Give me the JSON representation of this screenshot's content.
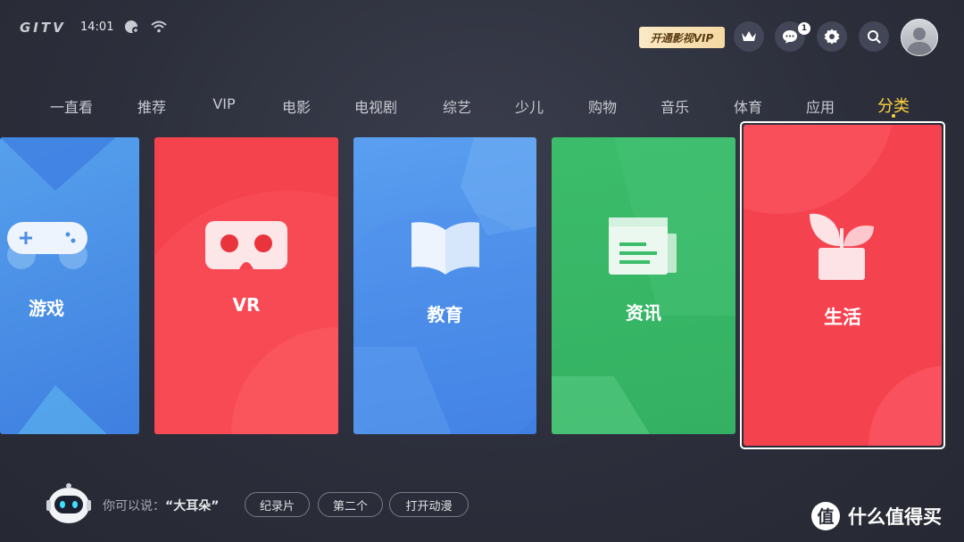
{
  "status_bar": {
    "logo": "GITV",
    "time": "14:01"
  },
  "header": {
    "vip_label": "开通影视VIP",
    "message_count": "1"
  },
  "nav": {
    "tabs": [
      {
        "label": "一直看"
      },
      {
        "label": "推荐"
      },
      {
        "label": "VIP"
      },
      {
        "label": "电影"
      },
      {
        "label": "电视剧"
      },
      {
        "label": "综艺"
      },
      {
        "label": "少儿"
      },
      {
        "label": "购物"
      },
      {
        "label": "音乐"
      },
      {
        "label": "体育"
      },
      {
        "label": "应用"
      },
      {
        "label": "分类"
      }
    ],
    "active": "分类"
  },
  "cards": [
    {
      "label": "游戏",
      "icon": "gamepad-icon",
      "color": "#4a90e2"
    },
    {
      "label": "VR",
      "icon": "vr-headset-icon",
      "color": "#f5434e"
    },
    {
      "label": "教育",
      "icon": "book-icon",
      "color": "#4a8fe4"
    },
    {
      "label": "资讯",
      "icon": "newspaper-icon",
      "color": "#3dbb6c"
    },
    {
      "label": "生活",
      "icon": "plant-icon",
      "color": "#f54552"
    }
  ],
  "voice": {
    "hint_prefix": "你可以说：",
    "hint_keyword": "“大耳朵”",
    "suggestions": [
      "纪录片",
      "第二个",
      "打开动漫"
    ]
  },
  "watermark": {
    "text": "什么值得买",
    "icon_char": "值"
  }
}
